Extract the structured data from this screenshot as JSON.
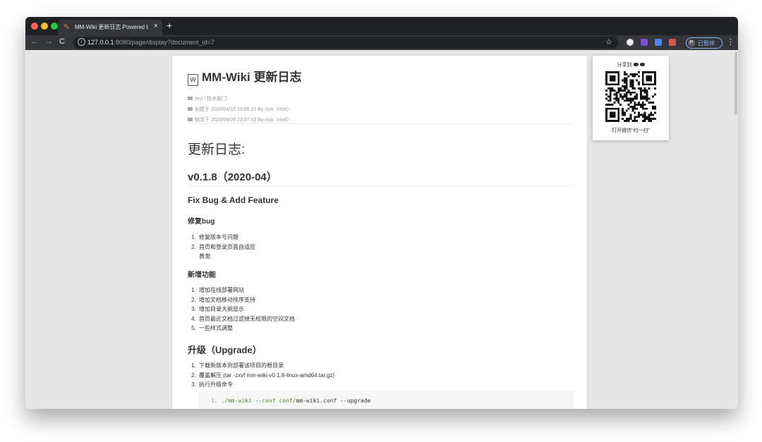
{
  "browser": {
    "tab_title": "MM-Wiki 更新日志 Powered by",
    "tab_close": "×",
    "new_tab": "+",
    "url_host": "127.0.0.1",
    "url_rest": ":8080/page/display?document_id=7",
    "profile_initial": "P",
    "profile_label": "已暂停"
  },
  "doc": {
    "title": "MM-Wiki 更新日志",
    "space_path": "test / 技术部门",
    "created": "创建于 2020/04/12 10:56:10 By root（root）",
    "modified": "修改于 2020/06/09 23:07:43 By root（root）"
  },
  "content": {
    "h1": "更新日志:",
    "version": "v0.1.8（2020-04）",
    "section": "Fix Bug & Add Feature",
    "fix_heading": "修复bug",
    "fix_items": [
      "修复版本号问题",
      "首页和登录页面自适应"
    ],
    "fix_continuation": "黄渤",
    "feature_heading": "新增功能",
    "feature_items": [
      "增加在线部署网站",
      "增加文档移动排序支持",
      "增加目录大纲显示",
      "首页最近文档过滤掉无权限的空间文档",
      "一些样式调整"
    ],
    "upgrade_heading": "升级（Upgrade）",
    "upgrade_items": [
      "下载新版本到部署该项目的根目录",
      "覆盖解压 (tar -zxvf mm-wiki-v0.1.8-linux-amd64.tar.gz)",
      "执行升级命令"
    ],
    "code": {
      "line_no": "1.",
      "cmd": "./mm-wiki",
      "flag": "--conf",
      "dir": "conf/",
      "file": "mm-wiki.conf",
      "tail": "--upgrade"
    }
  },
  "share": {
    "title": "分享到",
    "caption": "打开微信“扫一扫”"
  }
}
